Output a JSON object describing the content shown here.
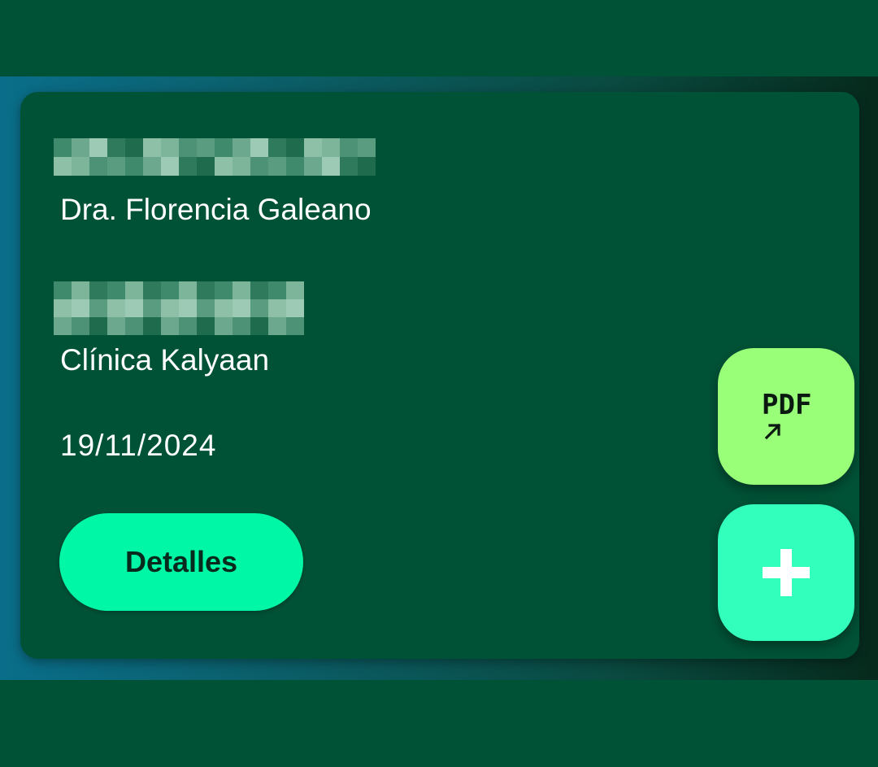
{
  "card": {
    "doctor_name": "Dra. Florencia Galeano",
    "clinic_name": "Clínica Kalyaan",
    "date": "19/11/2024",
    "details_label": "Detalles"
  },
  "fabs": {
    "pdf_label": "PDF",
    "pdf_icon": "pdf-open-external-icon",
    "add_icon": "plus-icon"
  },
  "colors": {
    "background": "#005236",
    "details_button": "#00f7a5",
    "pdf_button": "#99ff78",
    "add_button": "#33ffbc"
  }
}
